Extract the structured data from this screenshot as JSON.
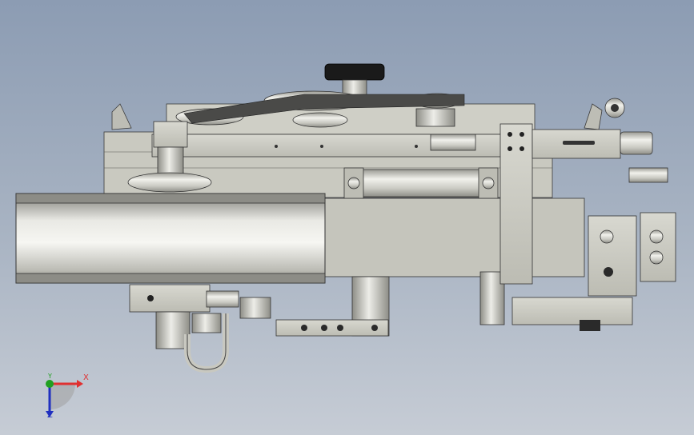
{
  "viewport": {
    "background_top": "#8c9cb3",
    "background_bottom": "#c6ccd5",
    "model_name": "mechanical-assembly"
  },
  "triad": {
    "x_label": "X",
    "y_label": "Y",
    "z_label": "Z",
    "x_color": "#e03030",
    "y_color": "#20a020",
    "z_color": "#2030c0"
  }
}
